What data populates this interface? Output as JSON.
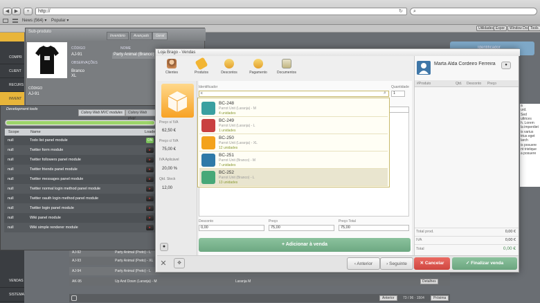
{
  "browser": {
    "url": "http://",
    "bookmarks": [
      "News (564) ▾",
      "Popular ▾"
    ],
    "buttons": [
      "Utilidades",
      "Expor",
      "Window Dock",
      "Tools"
    ]
  },
  "leftnav": {
    "items": [
      "COMPR",
      "CLIENT",
      "RECURS",
      "INVENT",
      "VENDAS",
      "SISTEMA"
    ]
  },
  "subproduct": {
    "title": "Sub-produto",
    "tabs": [
      "Inventário",
      "Avançado",
      "Geral"
    ],
    "codigo_label": "CÓDIGO",
    "codigo": "AJ-91",
    "nome_label": "NOME",
    "nome": "Party Animal (Branco) - XL",
    "obs_label": "OBSERVAÇÕES",
    "color": "Branco",
    "size": "XL",
    "codigo2_label": "CÓDIGO",
    "codigo2": "AJ-91",
    "identificador": "Identificador"
  },
  "devtools": {
    "title": "Development tools",
    "tabs": [
      "Colony Web MVC modules",
      "Colony Web plugi"
    ],
    "headers": {
      "scope": "Scope",
      "name": "Name",
      "loaded": "Loade"
    },
    "rows": [
      {
        "scope": "null",
        "name": "Todo list panel module",
        "state": "ON"
      },
      {
        "scope": "null",
        "name": "Twitter form module",
        "state": "▸"
      },
      {
        "scope": "null",
        "name": "Twitter followers panel module",
        "state": "▸"
      },
      {
        "scope": "null",
        "name": "Twitter friends panel module",
        "state": "▸"
      },
      {
        "scope": "null",
        "name": "Twitter messages panel module",
        "state": "▸"
      },
      {
        "scope": "null",
        "name": "Twitter normal login method panel module",
        "state": "▸"
      },
      {
        "scope": "null",
        "name": "Twitter oauth login method panel module",
        "state": "▸"
      },
      {
        "scope": "null",
        "name": "Twitter login panel module",
        "state": "▸"
      },
      {
        "scope": "null",
        "name": "Wiki panel module",
        "state": "▸"
      },
      {
        "scope": "null",
        "name": "Wiki simple renderer module",
        "state": "▸"
      }
    ]
  },
  "bglist": {
    "rows": [
      {
        "code": "AJ-92",
        "name": "Party Animal (Preto) - L"
      },
      {
        "code": "AJ-93",
        "name": "Party Animal (Preto) - XL"
      },
      {
        "code": "AJ-94",
        "name": "Party Animal (Preto) - L"
      },
      {
        "code": "AK-95",
        "name": "Up And Down (Laranja) - M",
        "extra": "Laranja M",
        "btn": "Detalhes"
      }
    ],
    "pager": {
      "prev": "Anterior",
      "info": "73 / 96 · 1504",
      "next": "Próxima"
    }
  },
  "modal": {
    "title": "Loja Brago - Vendas",
    "tabs": [
      "Clientes",
      "Produtos",
      "Descontos",
      "Pagamento",
      "Documentos"
    ],
    "identificador_label": "Identificador",
    "quantidade_label": "Quantidade",
    "search_value": "c",
    "quantity": "1",
    "preco_siva_label": "Preço s/ IVA",
    "preco_siva": "62,50 €",
    "preco_civa_label": "Preço c/ IVA",
    "preco_civa": "75,00 €",
    "iva_label": "IVA Aplicável",
    "iva": "20,00 %",
    "stock_label": "Qtd. Stock",
    "stock": "12,00",
    "desconto_label": "Desconto",
    "desconto": "0,00",
    "preco_label": "Preço",
    "preco": "75,00",
    "preco_total_label": "Preço Total",
    "preco_total": "75,00",
    "add_label": "+ Adicionar à venda",
    "prev_label": "‹ Anterior",
    "next_label": "› Seguinte",
    "cancel_label": "✕ Cancelar",
    "finish_label": "✓ Finalizar venda",
    "dropdown": [
      {
        "code": "BC-248",
        "name": "Parrot Unit (Laranja) - M",
        "qty": "4 unidades",
        "color": "#3aa0a0"
      },
      {
        "code": "BC-249",
        "name": "Parrot Unit (Laranja) - L",
        "qty": "1 unidades",
        "color": "#c94040"
      },
      {
        "code": "BC-250",
        "name": "Parrot Unit (Laranja) - XL",
        "qty": "12 unidades",
        "color": "#f3a21c"
      },
      {
        "code": "BC-251",
        "name": "Parrot Unit (Branco) - M",
        "qty": "7 unidades",
        "color": "#2f7aa8"
      },
      {
        "code": "BC-252",
        "name": "Parrot Unit (Branco) - L",
        "qty": "13 unidades",
        "color": "#47a878"
      }
    ],
    "customer": "Marta Alda Cordeiro Ferreira",
    "cart_headers": [
      "#Produto",
      "Qtd.",
      "Desconto",
      "Preço"
    ],
    "totals": [
      {
        "label": "Total prod.",
        "value": "0,00 €"
      },
      {
        "label": "IVA",
        "value": "0,00 €"
      },
      {
        "label": "Total",
        "value": "0,00 €"
      }
    ]
  },
  "side_text": "a\nurd.\nSed\nultrices\nh. Lorem\nla imperdiet\nis varius\ntrius eget\nlarch\nis posuere\nnt tristique\na posuere"
}
